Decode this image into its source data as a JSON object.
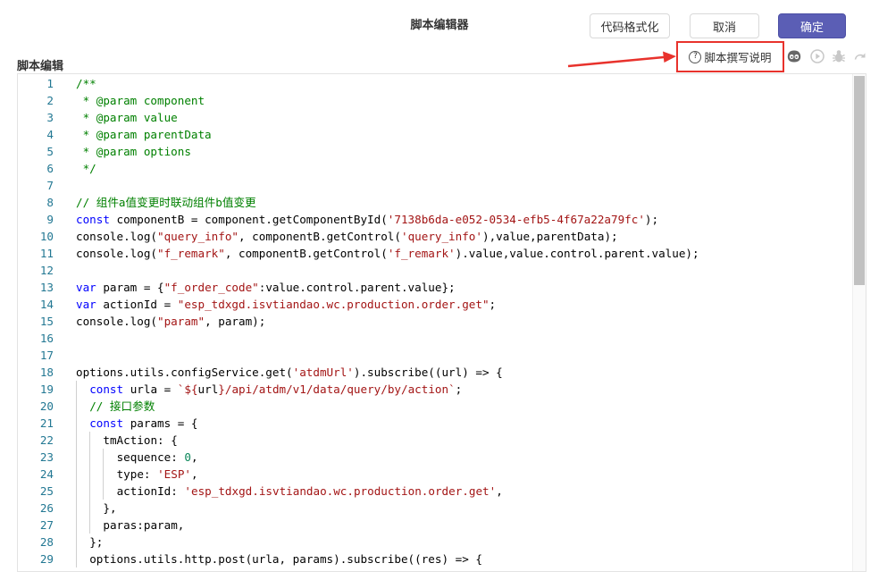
{
  "dialog": {
    "title": "脚本编辑器",
    "format_label": "代码格式化",
    "cancel_label": "取消",
    "ok_label": "确定",
    "section_label": "脚本编辑",
    "help_label": "脚本撰写说明",
    "accent_color": "#5b5eb5",
    "highlight_color": "#e8322c"
  },
  "toolbar_icons": [
    "robot-icon",
    "play-icon",
    "debug-bug-icon",
    "redo-icon"
  ],
  "editor": {
    "lines": [
      {
        "n": "1",
        "indent": 0,
        "t": [
          [
            "cm",
            "/**"
          ]
        ]
      },
      {
        "n": "2",
        "indent": 0,
        "t": [
          [
            "cm",
            " * @param component"
          ]
        ]
      },
      {
        "n": "3",
        "indent": 0,
        "t": [
          [
            "cm",
            " * @param value"
          ]
        ]
      },
      {
        "n": "4",
        "indent": 0,
        "t": [
          [
            "cm",
            " * @param parentData"
          ]
        ]
      },
      {
        "n": "5",
        "indent": 0,
        "t": [
          [
            "cm",
            " * @param options"
          ]
        ]
      },
      {
        "n": "6",
        "indent": 0,
        "t": [
          [
            "cm",
            " */"
          ]
        ]
      },
      {
        "n": "7",
        "indent": 0,
        "t": []
      },
      {
        "n": "8",
        "indent": 0,
        "t": [
          [
            "cm",
            "// 组件a值变更时联动组件b值变更"
          ]
        ]
      },
      {
        "n": "9",
        "indent": 0,
        "t": [
          [
            "kw",
            "const"
          ],
          [
            "pl",
            " componentB = component.getComponentById("
          ],
          [
            "st",
            "'7138b6da-e052-0534-efb5-4f67a22a79fc'"
          ],
          [
            "pl",
            ");"
          ]
        ]
      },
      {
        "n": "10",
        "indent": 0,
        "t": [
          [
            "pl",
            "console.log("
          ],
          [
            "st",
            "\"query_info\""
          ],
          [
            "pl",
            ", componentB.getControl("
          ],
          [
            "st",
            "'query_info'"
          ],
          [
            "pl",
            "),value,parentData);"
          ]
        ]
      },
      {
        "n": "11",
        "indent": 0,
        "t": [
          [
            "pl",
            "console.log("
          ],
          [
            "st",
            "\"f_remark\""
          ],
          [
            "pl",
            ", componentB.getControl("
          ],
          [
            "st",
            "'f_remark'"
          ],
          [
            "pl",
            ").value,value.control.parent.value);"
          ]
        ]
      },
      {
        "n": "12",
        "indent": 0,
        "t": []
      },
      {
        "n": "13",
        "indent": 0,
        "t": [
          [
            "kw",
            "var"
          ],
          [
            "pl",
            " param = {"
          ],
          [
            "st",
            "\"f_order_code\""
          ],
          [
            "pl",
            ":value.control.parent.value};"
          ]
        ]
      },
      {
        "n": "14",
        "indent": 0,
        "t": [
          [
            "kw",
            "var"
          ],
          [
            "pl",
            " actionId = "
          ],
          [
            "st",
            "\"esp_tdxgd.isvtiandao.wc.production.order.get\""
          ],
          [
            "pl",
            ";"
          ]
        ]
      },
      {
        "n": "15",
        "indent": 0,
        "t": [
          [
            "pl",
            "console.log("
          ],
          [
            "st",
            "\"param\""
          ],
          [
            "pl",
            ", param);"
          ]
        ]
      },
      {
        "n": "16",
        "indent": 0,
        "t": []
      },
      {
        "n": "17",
        "indent": 0,
        "t": []
      },
      {
        "n": "18",
        "indent": 0,
        "t": [
          [
            "pl",
            "options.utils.configService.get("
          ],
          [
            "st",
            "'atdmUrl'"
          ],
          [
            "pl",
            ").subscribe((url) => {"
          ]
        ]
      },
      {
        "n": "19",
        "indent": 1,
        "t": [
          [
            "kw",
            "const"
          ],
          [
            "pl",
            " urla = "
          ],
          [
            "st",
            "`${"
          ],
          [
            "pl",
            "url"
          ],
          [
            "st",
            "}/api/atdm/v1/data/query/by/action`"
          ],
          [
            "pl",
            ";"
          ]
        ]
      },
      {
        "n": "20",
        "indent": 1,
        "t": [
          [
            "cm",
            "// 接口参数"
          ]
        ]
      },
      {
        "n": "21",
        "indent": 1,
        "t": [
          [
            "kw",
            "const"
          ],
          [
            "pl",
            " params = {"
          ]
        ]
      },
      {
        "n": "22",
        "indent": 2,
        "t": [
          [
            "pl",
            "tmAction: {"
          ]
        ]
      },
      {
        "n": "23",
        "indent": 3,
        "t": [
          [
            "pl",
            "sequence: "
          ],
          [
            "num",
            "0"
          ],
          [
            "pl",
            ","
          ]
        ]
      },
      {
        "n": "24",
        "indent": 3,
        "t": [
          [
            "pl",
            "type: "
          ],
          [
            "st",
            "'ESP'"
          ],
          [
            "pl",
            ","
          ]
        ]
      },
      {
        "n": "25",
        "indent": 3,
        "t": [
          [
            "pl",
            "actionId: "
          ],
          [
            "st",
            "'esp_tdxgd.isvtiandao.wc.production.order.get'"
          ],
          [
            "pl",
            ","
          ]
        ]
      },
      {
        "n": "26",
        "indent": 2,
        "t": [
          [
            "pl",
            "},"
          ]
        ]
      },
      {
        "n": "27",
        "indent": 2,
        "t": [
          [
            "pl",
            "paras:param,"
          ]
        ]
      },
      {
        "n": "28",
        "indent": 1,
        "t": [
          [
            "pl",
            "};"
          ]
        ]
      },
      {
        "n": "29",
        "indent": 1,
        "t": [
          [
            "pl",
            "options.utils.http.post(urla, params).subscribe((res) => {"
          ]
        ]
      }
    ]
  }
}
